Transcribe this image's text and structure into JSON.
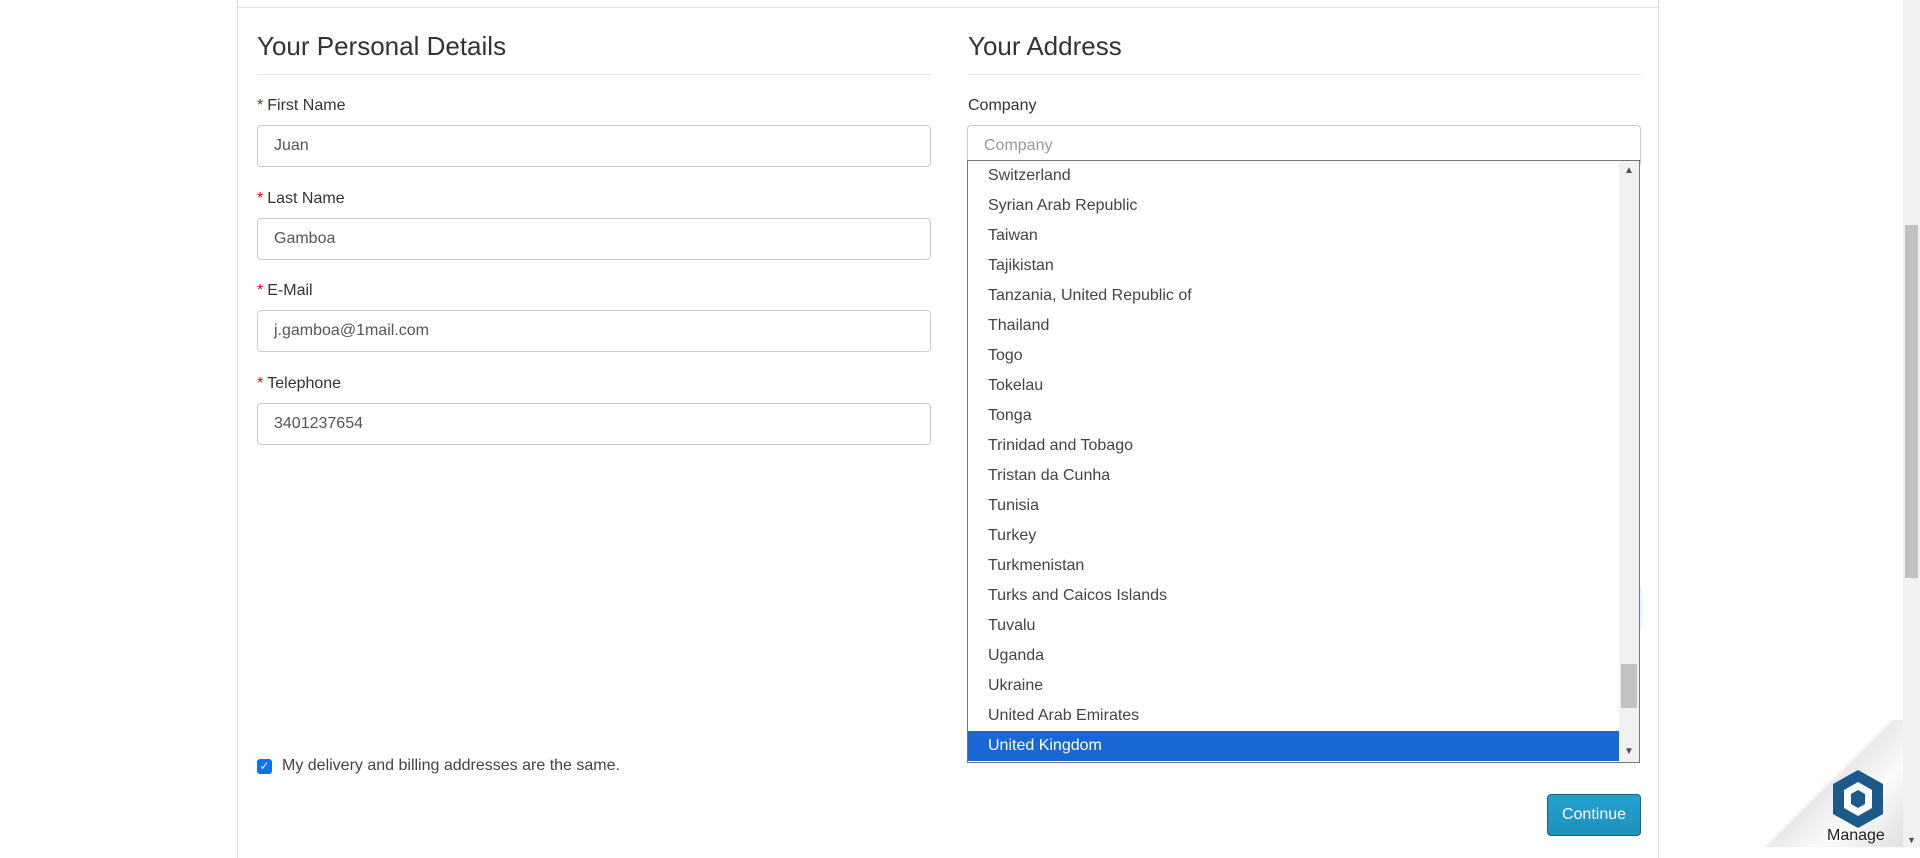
{
  "personal": {
    "title": "Your Personal Details",
    "first_name_label": "First Name",
    "first_name_value": "Juan",
    "last_name_label": "Last Name",
    "last_name_value": "Gamboa",
    "email_label": "E-Mail",
    "email_value": "j.gamboa@1mail.com",
    "telephone_label": "Telephone",
    "telephone_value": "3401237654",
    "required_marker": "*"
  },
  "address": {
    "title": "Your Address",
    "company_label": "Company",
    "company_placeholder": "Company"
  },
  "country_dropdown": {
    "options": [
      "Switzerland",
      "Syrian Arab Republic",
      "Taiwan",
      "Tajikistan",
      "Tanzania, United Republic of",
      "Thailand",
      "Togo",
      "Tokelau",
      "Tonga",
      "Trinidad and Tobago",
      "Tristan da Cunha",
      "Tunisia",
      "Turkey",
      "Turkmenistan",
      "Turks and Caicos Islands",
      "Tuvalu",
      "Uganda",
      "Ukraine",
      "United Arab Emirates",
      "United Kingdom"
    ],
    "selected": "United Kingdom"
  },
  "same_address": {
    "label": "My delivery and billing addresses are the same.",
    "checked": true
  },
  "continue_label": "Continue",
  "manage_label": "Manage",
  "colors": {
    "selected_option": "#1967d2",
    "continue_button": "#229ac8",
    "required": "#e00000",
    "checkbox": "#0075ff"
  }
}
